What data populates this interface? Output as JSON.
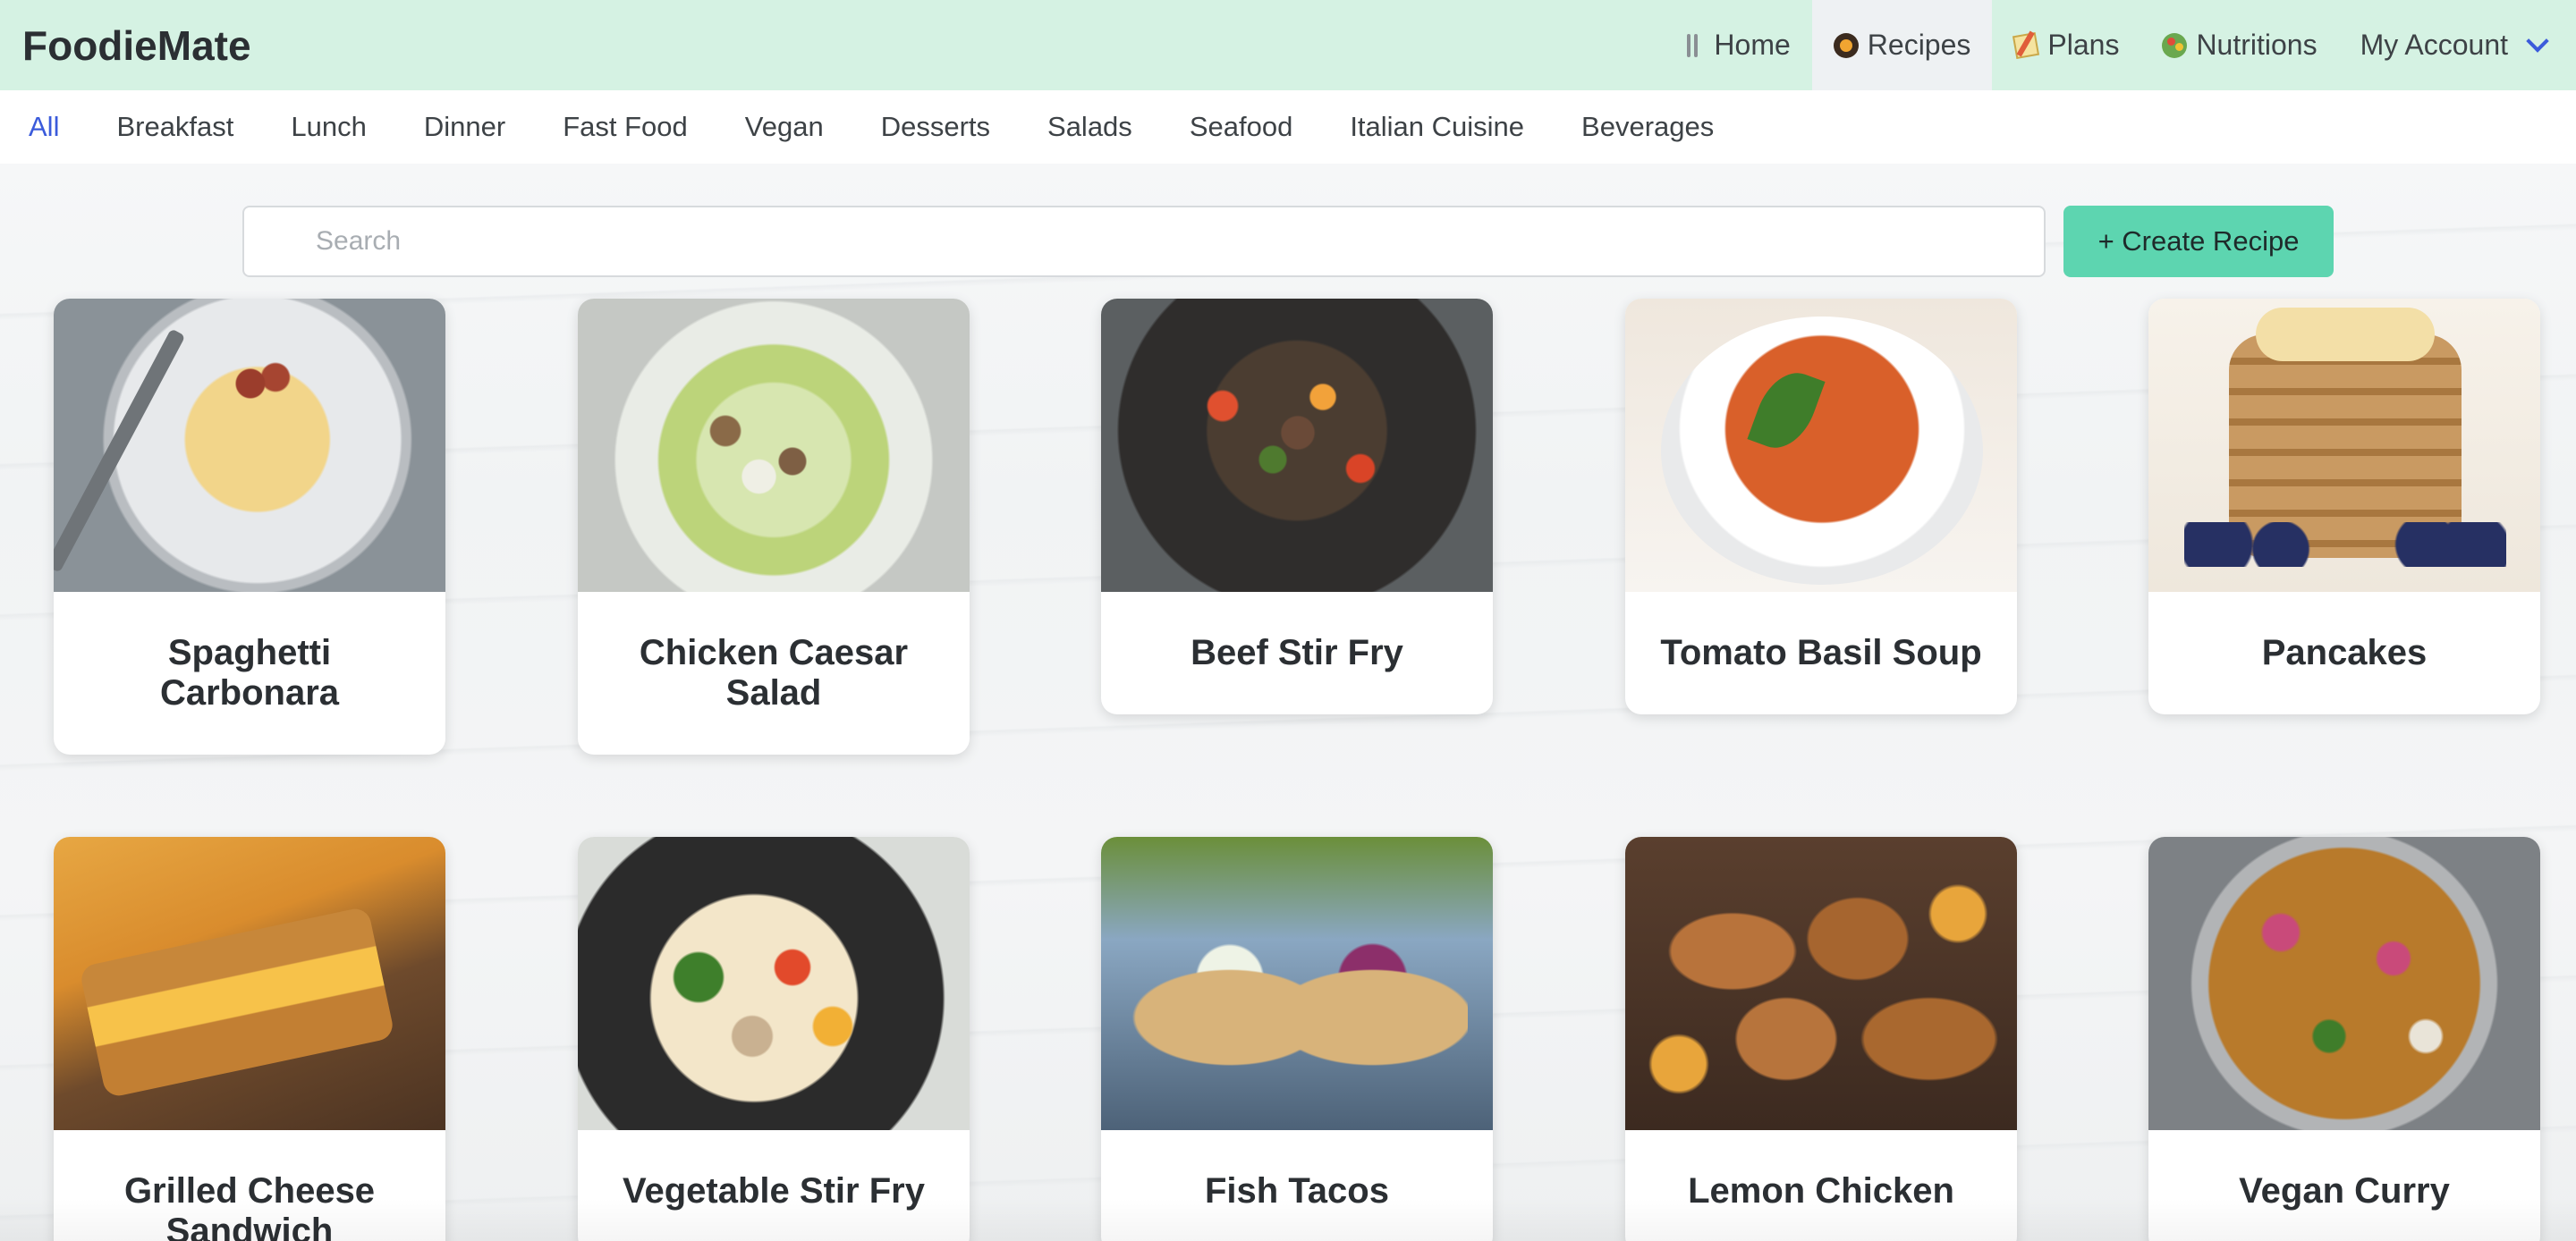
{
  "app": {
    "brand": "FoodieMate"
  },
  "nav": {
    "items": [
      {
        "label": "Home",
        "icon": "fork-knife-icon",
        "active": false
      },
      {
        "label": "Recipes",
        "icon": "cooking-pan-icon",
        "active": true
      },
      {
        "label": "Plans",
        "icon": "memo-icon",
        "active": false
      },
      {
        "label": "Nutritions",
        "icon": "salad-icon",
        "active": false
      }
    ],
    "account_label": "My Account"
  },
  "categories": {
    "items": [
      "All",
      "Breakfast",
      "Lunch",
      "Dinner",
      "Fast Food",
      "Vegan",
      "Desserts",
      "Salads",
      "Seafood",
      "Italian Cuisine",
      "Beverages"
    ],
    "active": "All"
  },
  "search": {
    "placeholder": "Search",
    "value": ""
  },
  "actions": {
    "create_label": "+ Create Recipe"
  },
  "recipes": [
    {
      "title": "Spaghetti Carbonara",
      "image": "spaghetti-carbonara-photo"
    },
    {
      "title": "Chicken Caesar Salad",
      "image": "chicken-caesar-salad-photo"
    },
    {
      "title": "Beef Stir Fry",
      "image": "beef-stir-fry-photo"
    },
    {
      "title": "Tomato Basil Soup",
      "image": "tomato-basil-soup-photo"
    },
    {
      "title": "Pancakes",
      "image": "pancakes-photo"
    },
    {
      "title": "Grilled Cheese Sandwich",
      "image": "grilled-cheese-photo"
    },
    {
      "title": "Vegetable Stir Fry",
      "image": "vegetable-stir-fry-photo"
    },
    {
      "title": "Fish Tacos",
      "image": "fish-tacos-photo"
    },
    {
      "title": "Lemon Chicken",
      "image": "lemon-chicken-photo"
    },
    {
      "title": "Vegan Curry",
      "image": "vegan-curry-photo"
    }
  ],
  "colors": {
    "topbar": "#d5f2e3",
    "accent": "#3b5bdb",
    "create_button": "#5dd5b0"
  }
}
